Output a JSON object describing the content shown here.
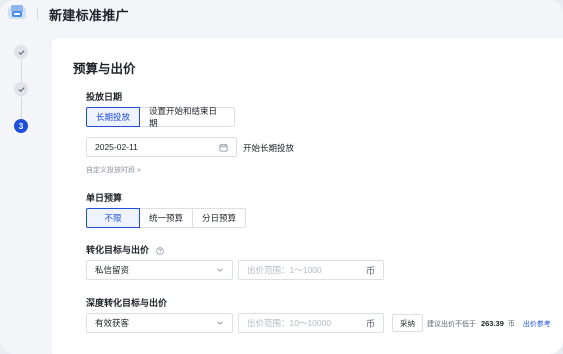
{
  "header": {
    "title": "新建标准推广"
  },
  "steps": {
    "items": [
      {
        "state": "done"
      },
      {
        "state": "done"
      },
      {
        "state": "active",
        "number": "3"
      }
    ]
  },
  "main": {
    "section_title": "预算与出价",
    "schedule": {
      "label": "投放日期",
      "options": [
        "长期投放",
        "设置开始和结束日期"
      ],
      "selected": "长期投放",
      "date_value": "2025-02-11",
      "date_suffix": "开始长期投放",
      "custom_time_link": "自定义投放时段",
      "custom_time_arrow": "»"
    },
    "daily_budget": {
      "label": "单日预算",
      "options": [
        "不限",
        "统一预算",
        "分日预算"
      ],
      "selected": "不限"
    },
    "conversion": {
      "label": "转化目标与出价",
      "select_value": "私信留资",
      "bid_placeholder": "出价范围：1～1000",
      "bid_unit": "币"
    },
    "deep_conversion": {
      "label": "深度转化目标与出价",
      "select_value": "有效获客",
      "bid_placeholder": "出价范围：10～10000",
      "bid_unit": "币",
      "adopt_button": "采纳",
      "suggest_prefix": "建议出价不低于",
      "suggest_value": "263.39",
      "suggest_unit": "币",
      "reference_link": "出价参考"
    }
  },
  "colors": {
    "accent": "#1f4fd8",
    "border": "#dcdfe6",
    "background": "#f3f5f9"
  }
}
